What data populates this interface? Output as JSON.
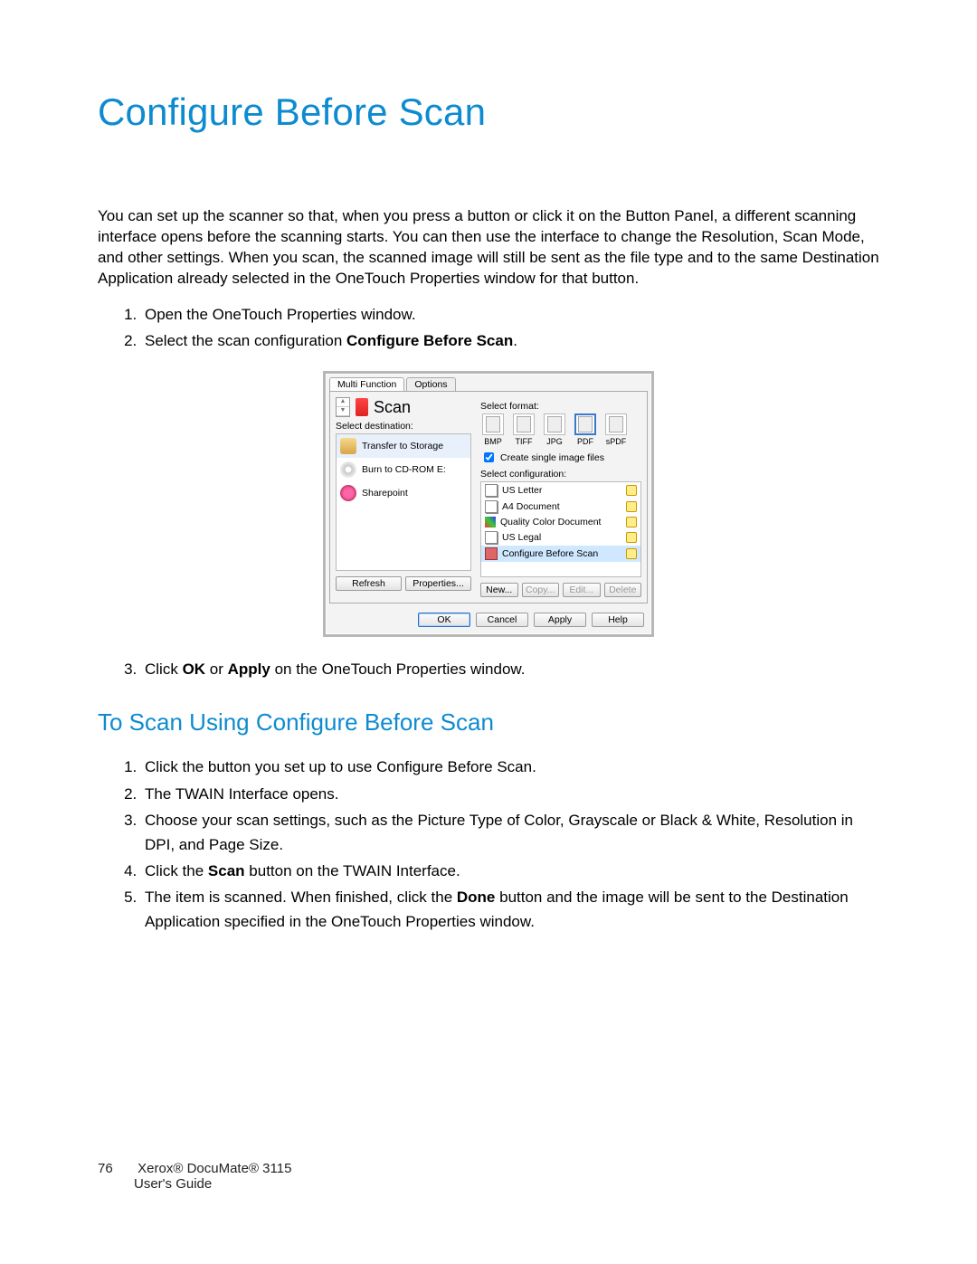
{
  "title": "Configure Before Scan",
  "intro": "You can set up the scanner so that, when you press a button or click it on the Button Panel, a different scanning interface opens before the scanning starts. You can then use the interface to change the Resolution, Scan Mode, and other settings. When you scan, the scanned image will still be sent as the file type and to the same Destination Application already selected in the OneTouch Properties window for that button.",
  "steps_a": {
    "s1": "Open the OneTouch Properties window.",
    "s2a": "Select the scan configuration ",
    "s2b": "Configure Before Scan",
    "s2c": ".",
    "s3a": "Click ",
    "s3b": "OK",
    "s3c": " or ",
    "s3d": "Apply",
    "s3e": " on the OneTouch Properties window."
  },
  "subheading": "To Scan Using Configure Before Scan",
  "steps_b": {
    "s1": "Click the button you set up to use Configure Before Scan.",
    "s2": "The TWAIN Interface opens.",
    "s3": "Choose your scan settings, such as the Picture Type of Color, Grayscale or Black & White, Resolution in DPI, and Page Size.",
    "s4a": "Click the ",
    "s4b": "Scan",
    "s4c": " button on the TWAIN Interface.",
    "s5a": "The item is scanned. When finished, click the ",
    "s5b": "Done",
    "s5c": " button and the image will be sent to the Destination Application specified in the OneTouch Properties window."
  },
  "footer": {
    "page": "76",
    "line1": "Xerox® DocuMate® 3115",
    "line2": "User's Guide"
  },
  "dialog": {
    "tabs": {
      "t1": "Multi Function",
      "t2": "Options"
    },
    "scan_label": "Scan",
    "dest_label": "Select destination:",
    "dests": {
      "d1": "Transfer to Storage",
      "d2": "Burn to CD-ROM  E:",
      "d3": "Sharepoint"
    },
    "fmt_label": "Select format:",
    "formats": {
      "f1": "BMP",
      "f2": "TIFF",
      "f3": "JPG",
      "f4": "PDF",
      "f5": "sPDF"
    },
    "create_single": "Create single image files",
    "cfg_label": "Select configuration:",
    "configs": {
      "c1": "US Letter",
      "c2": "A4 Document",
      "c3": "Quality Color Document",
      "c4": "US Legal",
      "c5": "Configure Before Scan"
    },
    "left_buttons": {
      "b1": "Refresh",
      "b2": "Properties..."
    },
    "right_buttons": {
      "b1": "New...",
      "b2": "Copy...",
      "b3": "Edit...",
      "b4": "Delete"
    },
    "bottom_buttons": {
      "b1": "OK",
      "b2": "Cancel",
      "b3": "Apply",
      "b4": "Help"
    }
  }
}
